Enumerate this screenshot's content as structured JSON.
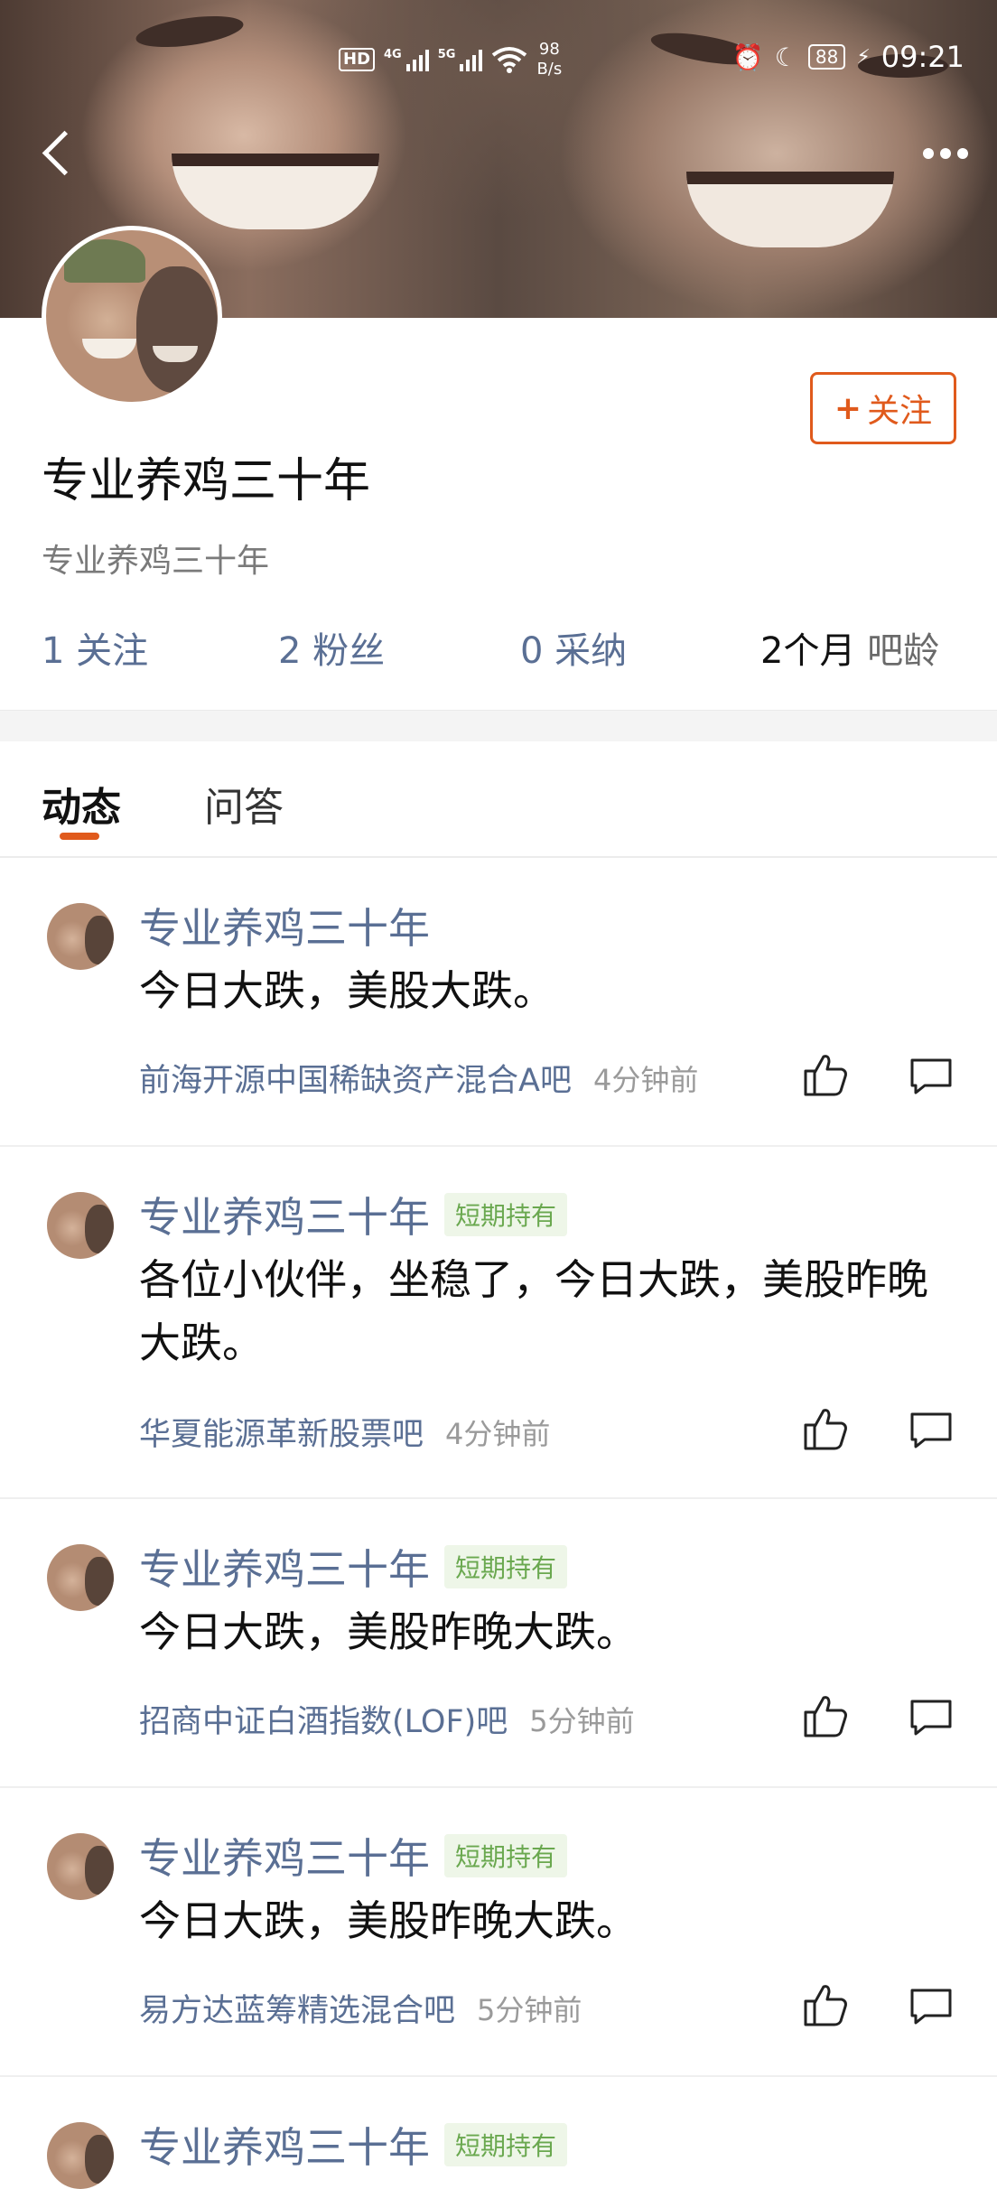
{
  "status_bar": {
    "hd": "HD",
    "sig1": "4G",
    "sig2": "5G",
    "speed_value": "98",
    "speed_unit": "B/s",
    "battery": "88",
    "time": "09:21"
  },
  "header": {
    "back_icon": "back-arrow-icon",
    "more_icon": "more-dots-icon"
  },
  "profile": {
    "follow_plus": "+",
    "follow_label": "关注",
    "username": "专业养鸡三十年",
    "signature": "专业养鸡三十年",
    "stats": [
      {
        "num": "1",
        "label": "关注"
      },
      {
        "num": "2",
        "label": "粉丝"
      },
      {
        "num": "0",
        "label": "采纳"
      },
      {
        "num": "2个月",
        "label": "吧龄"
      }
    ]
  },
  "tabs": [
    {
      "label": "动态",
      "active": true
    },
    {
      "label": "问答",
      "active": false
    }
  ],
  "posts": [
    {
      "name": "专业养鸡三十年",
      "tag": "",
      "content": "今日大跌，美股大跌。",
      "forum": "前海开源中国稀缺资产混合A吧",
      "time": "4分钟前"
    },
    {
      "name": "专业养鸡三十年",
      "tag": "短期持有",
      "content": "各位小伙伴，坐稳了，今日大跌，美股昨晚大跌。",
      "forum": "华夏能源革新股票吧",
      "time": "4分钟前"
    },
    {
      "name": "专业养鸡三十年",
      "tag": "短期持有",
      "content": "今日大跌，美股昨晚大跌。",
      "forum": "招商中证白酒指数(LOF)吧",
      "time": "5分钟前"
    },
    {
      "name": "专业养鸡三十年",
      "tag": "短期持有",
      "content": "今日大跌，美股昨晚大跌。",
      "forum": "易方达蓝筹精选混合吧",
      "time": "5分钟前"
    },
    {
      "name": "专业养鸡三十年",
      "tag": "短期持有",
      "content": "",
      "forum": "",
      "time": ""
    }
  ],
  "colors": {
    "accent": "#e05a1c",
    "link": "#5a6f94",
    "tag_green": "#6aa84f"
  }
}
